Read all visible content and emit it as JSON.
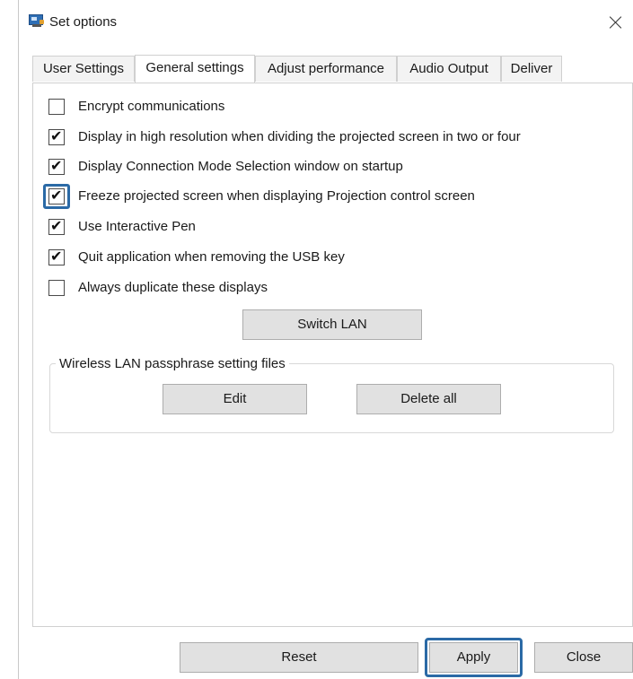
{
  "window": {
    "title": "Set options"
  },
  "tabs": [
    {
      "label": "User Settings",
      "active": false
    },
    {
      "label": "General settings",
      "active": true
    },
    {
      "label": "Adjust performance",
      "active": false
    },
    {
      "label": "Audio Output",
      "active": false
    },
    {
      "label": "Deliver",
      "active": false
    }
  ],
  "options": [
    {
      "label": "Encrypt communications",
      "checked": false
    },
    {
      "label": "Display in high resolution when dividing the projected screen in two or four",
      "checked": true
    },
    {
      "label": "Display Connection Mode Selection window on startup",
      "checked": true
    },
    {
      "label": "Freeze projected screen when displaying Projection control screen",
      "checked": true,
      "highlighted": true
    },
    {
      "label": "Use Interactive Pen",
      "checked": true
    },
    {
      "label": "Quit application when removing the USB key",
      "checked": true
    },
    {
      "label": "Always duplicate these displays",
      "checked": false
    }
  ],
  "check_glyph": "✔",
  "buttons": {
    "switch_lan": "Switch LAN",
    "edit": "Edit",
    "delete_all": "Delete all",
    "reset": "Reset",
    "apply": "Apply",
    "close": "Close"
  },
  "group": {
    "legend": "Wireless LAN passphrase setting files"
  },
  "colors": {
    "highlight": "#2b6aa6"
  },
  "icons": {
    "app": "projector-app-icon",
    "close": "close-icon",
    "check": "checkmark-icon"
  }
}
